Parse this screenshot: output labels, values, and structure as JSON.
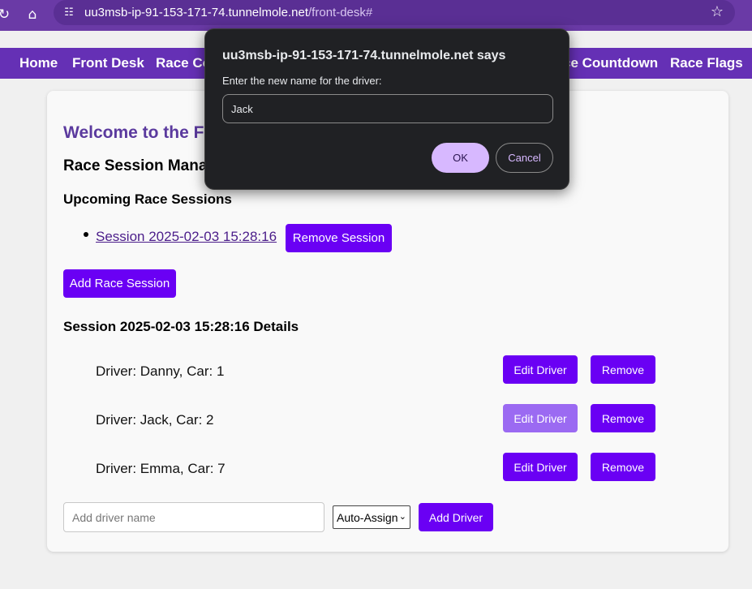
{
  "browser": {
    "url_host": "uu3msb-ip-91-153-171-74.tunnelmole.net",
    "url_path": "/front-desk#",
    "icons": [
      "reload-icon",
      "home-icon",
      "site-settings-icon",
      "bookmark-star-icon"
    ]
  },
  "nav": {
    "items": [
      "Home",
      "Front Desk",
      "Race Co",
      "ce Countdown",
      "Race Flags"
    ]
  },
  "main": {
    "welcome": "Welcome to the Fr",
    "manage_heading": "Race Session Mana",
    "upcoming_heading": "Upcoming Race Sessions",
    "sessions": [
      {
        "label": "Session 2025-02-03 15:28:16 ",
        "remove_label": "Remove Session"
      }
    ],
    "add_session_label": "Add Race Session",
    "details_heading": "Session 2025-02-03 15:28:16 Details",
    "drivers": [
      {
        "text": "Driver: Danny, Car: 1",
        "edit_label": "Edit Driver",
        "remove_label": "Remove"
      },
      {
        "text": "Driver: Jack, Car: 2",
        "edit_label": "Edit Driver",
        "remove_label": "Remove"
      },
      {
        "text": "Driver: Emma, Car: 7",
        "edit_label": "Edit Driver",
        "remove_label": "Remove"
      }
    ],
    "add_driver": {
      "placeholder": "Add driver name",
      "car_select": "Auto-Assign",
      "button_label": "Add Driver"
    }
  },
  "dialog": {
    "title": "uu3msb-ip-91-153-171-74.tunnelmole.net says",
    "message": "Enter the new name for the driver:",
    "input_value": "Jack",
    "ok_label": "OK",
    "cancel_label": "Cancel"
  },
  "colors": {
    "nav_bg": "#6530b5",
    "button_bg": "#6a00f4",
    "button_active_bg": "#9b6af2",
    "welcome_text": "#5b3a9e"
  }
}
